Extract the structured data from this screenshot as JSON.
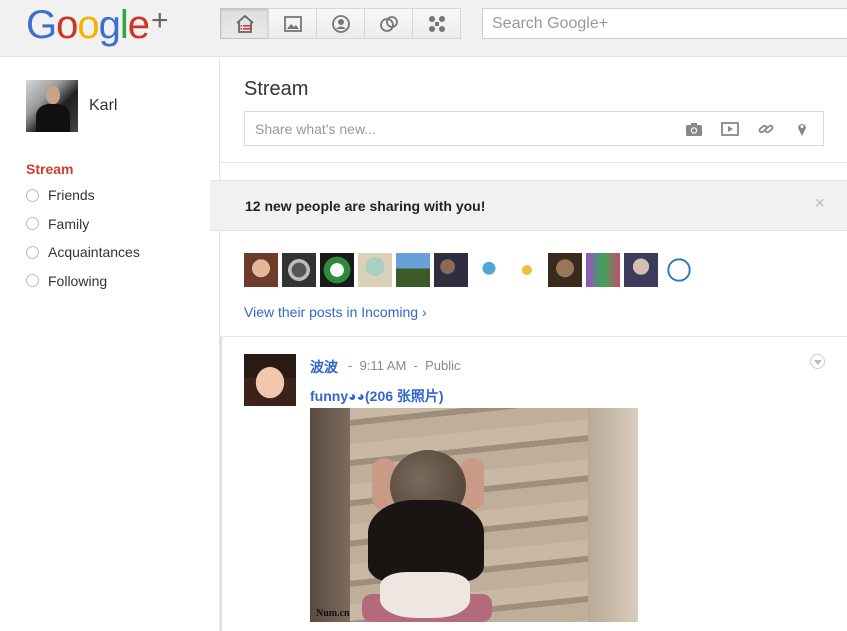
{
  "header": {
    "logo_letters": [
      "G",
      "o",
      "o",
      "g",
      "l",
      "e"
    ],
    "logo_plus": "+",
    "nav": [
      {
        "name": "home",
        "icon": "home-icon",
        "active": true
      },
      {
        "name": "photos",
        "icon": "photos-icon",
        "active": false
      },
      {
        "name": "profile",
        "icon": "profile-icon",
        "active": false
      },
      {
        "name": "circles",
        "icon": "circles-icon",
        "active": false
      },
      {
        "name": "games",
        "icon": "games-icon",
        "active": false
      }
    ],
    "search_placeholder": "Search Google+"
  },
  "sidebar": {
    "user_name": "Karl",
    "stream_label": "Stream",
    "circles": [
      {
        "label": "Friends"
      },
      {
        "label": "Family"
      },
      {
        "label": "Acquaintances"
      },
      {
        "label": "Following"
      }
    ]
  },
  "main": {
    "title": "Stream",
    "share_placeholder": "Share what's new...",
    "share_icons": [
      "camera-icon",
      "video-icon",
      "link-icon",
      "location-icon"
    ],
    "notice": {
      "text": "12 new people are sharing with you!",
      "close": "×"
    },
    "sharing_count": 12,
    "view_link": "View their posts in Incoming ›",
    "post": {
      "author": "波波",
      "sep1": "-",
      "time": "9:11 AM",
      "sep2": "-",
      "visibility": "Public",
      "title": "funny◕◕(206 张照片)",
      "image_watermark": "Num.cn"
    }
  },
  "colors": {
    "accent_red": "#d03c2d",
    "link_blue": "#3366cc",
    "post_rule_blue": "#d5e1f3"
  }
}
